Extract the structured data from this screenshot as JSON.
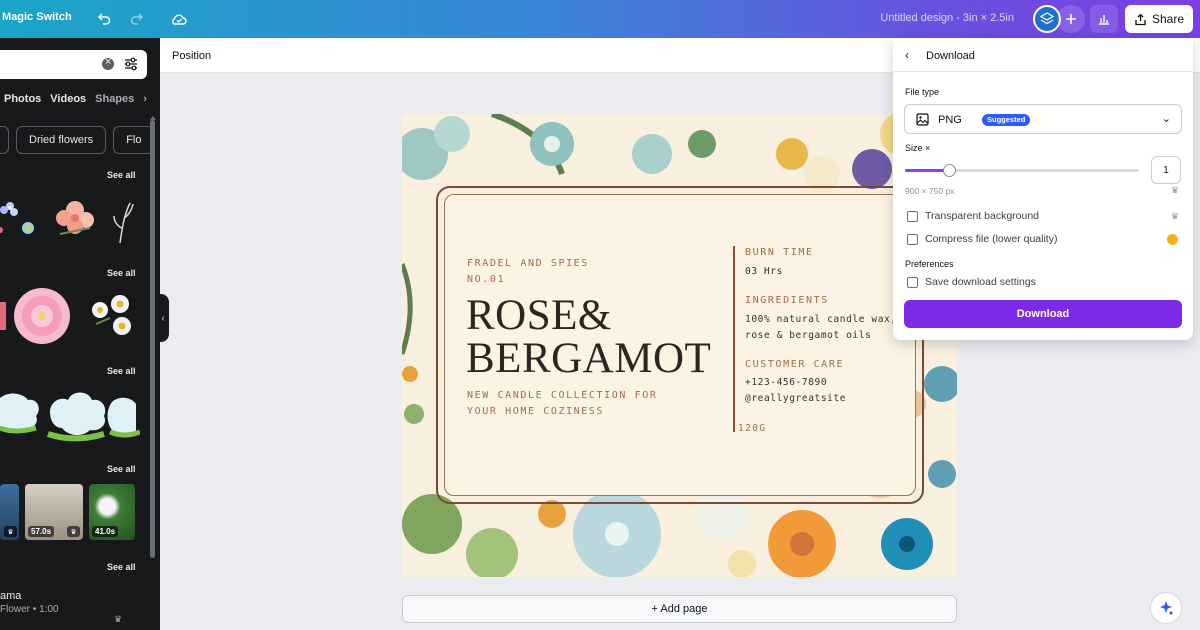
{
  "topbar": {
    "magic_switch": "Magic Switch",
    "design_title": "Untitled design - 3in × 2.5in",
    "share_label": "Share"
  },
  "sidebar": {
    "categories": [
      "Photos",
      "Videos",
      "Shapes"
    ],
    "chips": [
      "Dried flowers",
      "Flo"
    ],
    "see_all": "See all",
    "videos": [
      {
        "duration": "57.0s"
      },
      {
        "duration": "41.0s"
      }
    ],
    "audio": {
      "title": "ama",
      "subtitle": "Flower • 1:00"
    }
  },
  "toolbar": {
    "position_label": "Position"
  },
  "design": {
    "brand": "FRADEL AND SPIES",
    "number": "NO.01",
    "title_line1": "ROSE&",
    "title_line2": "BERGAMOT",
    "subtitle_line1": "NEW CANDLE COLLECTION FOR",
    "subtitle_line2": "YOUR HOME COZINESS",
    "burn_head": "BURN TIME",
    "burn_value": "03 Hrs",
    "ingredients_head": "INGREDIENTS",
    "ingredients_line1": "100% natural candle wax,",
    "ingredients_line2": "rose & bergamot oils",
    "care_head": "CUSTOMER CARE",
    "care_phone": "+123-456-7890",
    "care_site": "@reallygreatsite",
    "weight": "120G"
  },
  "add_page": "+ Add page",
  "download_panel": {
    "title": "Download",
    "file_type_label": "File type",
    "file_type_value": "PNG",
    "suggested_badge": "Suggested",
    "size_label": "Size ×",
    "size_value": "1",
    "size_slider_fraction": 0.19,
    "dimensions": "900 × 750 px",
    "transparent_bg": "Transparent background",
    "compress": "Compress file (lower quality)",
    "preferences_label": "Preferences",
    "save_settings": "Save download settings",
    "download_button": "Download"
  },
  "colors": {
    "accent": "#7d2ae8",
    "badge": "#2e5bff",
    "frame": "#7a4a34"
  }
}
